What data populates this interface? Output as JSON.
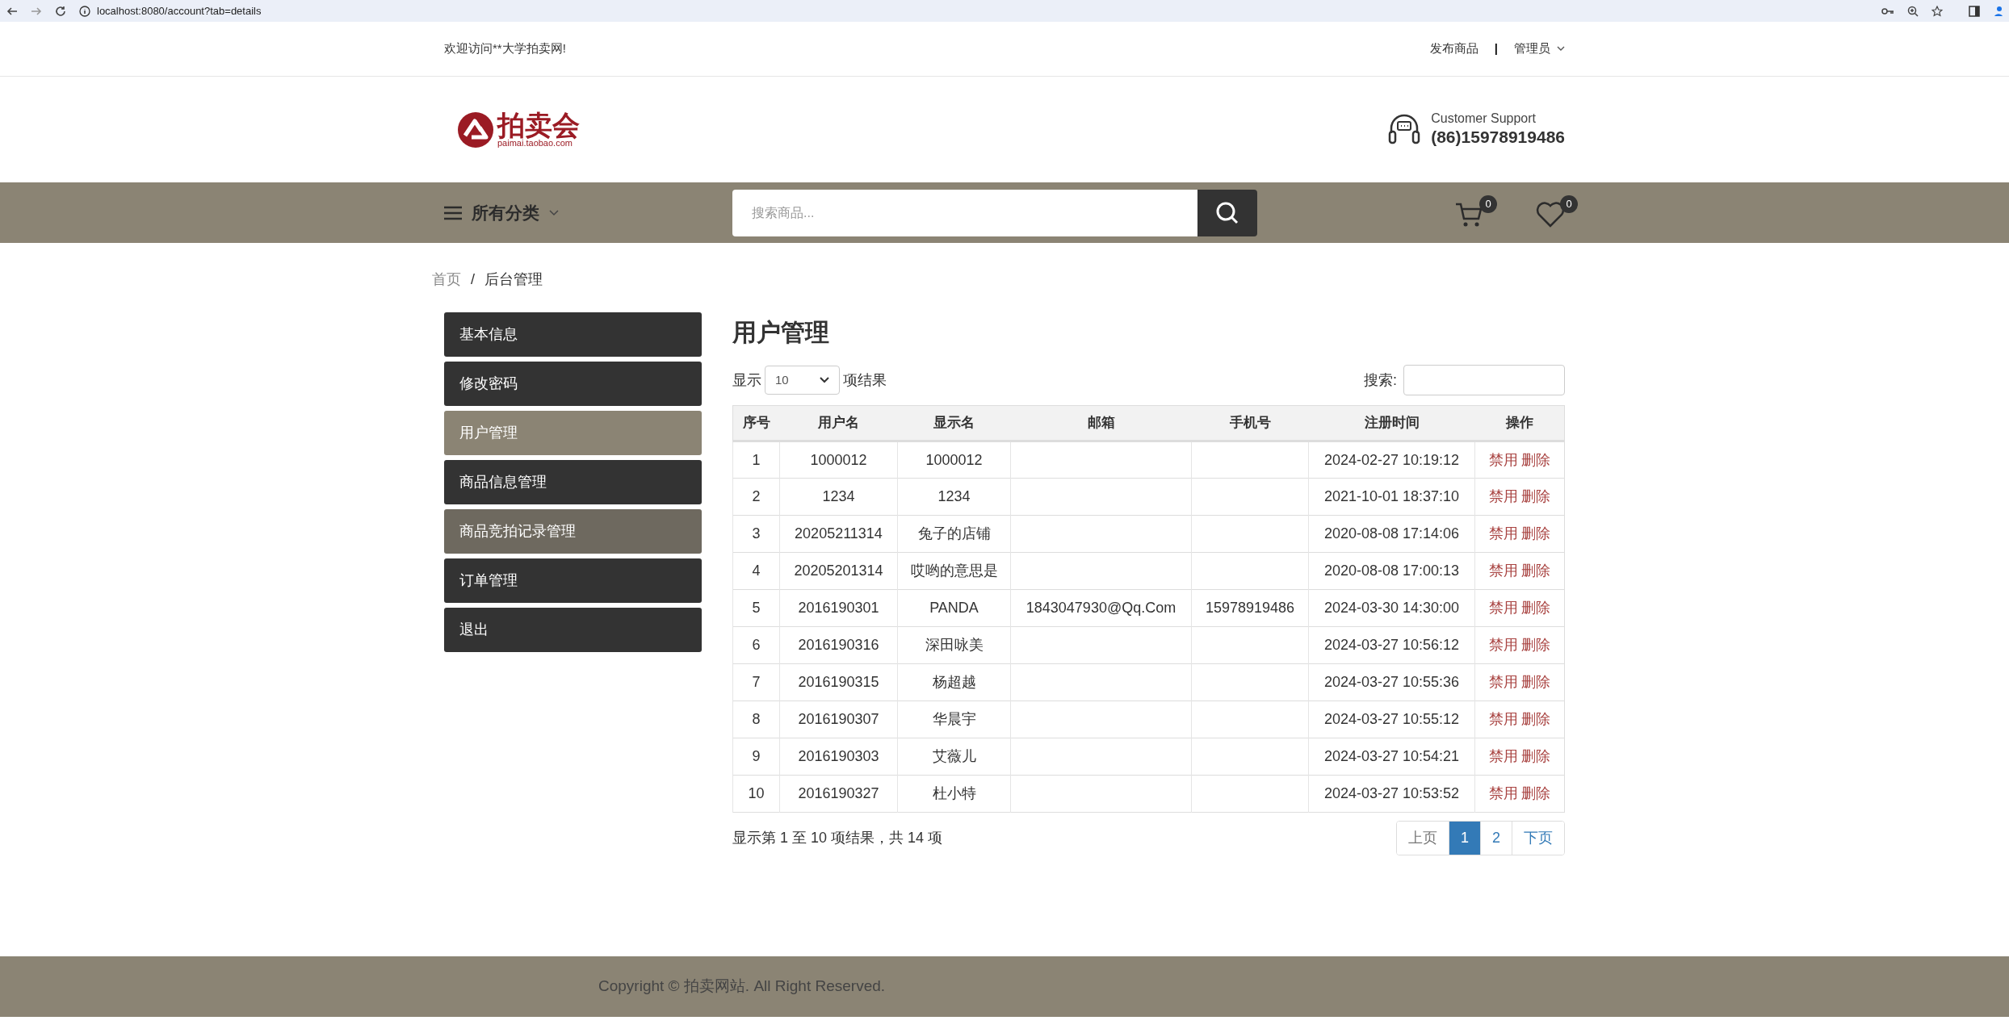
{
  "browser": {
    "url": "localhost:8080/account?tab=details"
  },
  "topbar": {
    "welcome": "欢迎访问**大学拍卖网!",
    "links": [
      {
        "label": "发布商品",
        "dropdown": false
      },
      {
        "label": "管理员",
        "dropdown": true
      }
    ],
    "separator": "|"
  },
  "header": {
    "logo_text": "拍卖会",
    "logo_subtext": "paimai.taobao.com",
    "support_label": "Customer Support",
    "support_phone": "(86)15978919486"
  },
  "navbar": {
    "categories": "所有分类",
    "search_placeholder": "搜索商品...",
    "cart_count": "0",
    "wishlist_count": "0"
  },
  "breadcrumb": [
    {
      "label": "首页",
      "current": false
    },
    {
      "label": "后台管理",
      "current": true
    }
  ],
  "breadcrumb_separator": "/",
  "sidebar": {
    "items": [
      {
        "label": "基本信息",
        "selected": false,
        "hovered": false
      },
      {
        "label": "修改密码",
        "selected": false,
        "hovered": false
      },
      {
        "label": "用户管理",
        "selected": true,
        "hovered": false
      },
      {
        "label": "商品信息管理",
        "selected": false,
        "hovered": false
      },
      {
        "label": "商品竞拍记录管理",
        "selected": false,
        "hovered": true
      },
      {
        "label": "订单管理",
        "selected": false,
        "hovered": false
      },
      {
        "label": "退出",
        "selected": false,
        "hovered": false
      }
    ]
  },
  "content": {
    "title": "用户管理",
    "length_prefix": "显示",
    "page_size": "10",
    "length_suffix": "项结果",
    "search_label": "搜索:",
    "table": {
      "columns": [
        "序号",
        "用户名",
        "显示名",
        "邮箱",
        "手机号",
        "注册时间",
        "操作"
      ],
      "rows": [
        {
          "index": "1",
          "username": "1000012",
          "display_name": "1000012",
          "registered": "2024-02-27 10:19:12",
          "actions": [
            "禁用",
            "删除"
          ]
        },
        {
          "index": "2",
          "username": "1234",
          "display_name": "1234",
          "registered": "2021-10-01 18:37:10",
          "actions": [
            "禁用",
            "删除"
          ]
        },
        {
          "index": "3",
          "username": "20205211314",
          "display_name": "兔子的店铺",
          "registered": "2020-08-08 17:14:06",
          "actions": [
            "禁用",
            "删除"
          ]
        },
        {
          "index": "4",
          "username": "20205201314",
          "display_name": "哎哟的意思是",
          "registered": "2020-08-08 17:00:13",
          "actions": [
            "禁用",
            "删除"
          ]
        },
        {
          "index": "5",
          "username": "2016190301",
          "display_name": "PANDA",
          "email": "1843047930@Qq.Com",
          "phone": "15978919486",
          "registered": "2024-03-30 14:30:00",
          "actions": [
            "禁用",
            "删除"
          ]
        },
        {
          "index": "6",
          "username": "2016190316",
          "display_name": "深田咏美",
          "registered": "2024-03-27 10:56:12",
          "actions": [
            "禁用",
            "删除"
          ]
        },
        {
          "index": "7",
          "username": "2016190315",
          "display_name": "杨超越",
          "registered": "2024-03-27 10:55:36",
          "actions": [
            "禁用",
            "删除"
          ]
        },
        {
          "index": "8",
          "username": "2016190307",
          "display_name": "华晨宇",
          "registered": "2024-03-27 10:55:12",
          "actions": [
            "禁用",
            "删除"
          ]
        },
        {
          "index": "9",
          "username": "2016190303",
          "display_name": "艾薇儿",
          "registered": "2024-03-27 10:54:21",
          "actions": [
            "禁用",
            "删除"
          ]
        },
        {
          "index": "10",
          "username": "2016190327",
          "display_name": "杜小特",
          "registered": "2024-03-27 10:53:52",
          "actions": [
            "禁用",
            "删除"
          ]
        }
      ]
    },
    "info": "显示第 1 至 10 项结果，共 14 项",
    "pagination": [
      {
        "label": "上页",
        "selected": false
      },
      {
        "label": "1",
        "selected": true
      },
      {
        "label": "2",
        "selected": false
      },
      {
        "label": "下页",
        "selected": false
      }
    ]
  },
  "footer": {
    "copyright": "Copyright © 拍卖网站. All Right Reserved."
  }
}
